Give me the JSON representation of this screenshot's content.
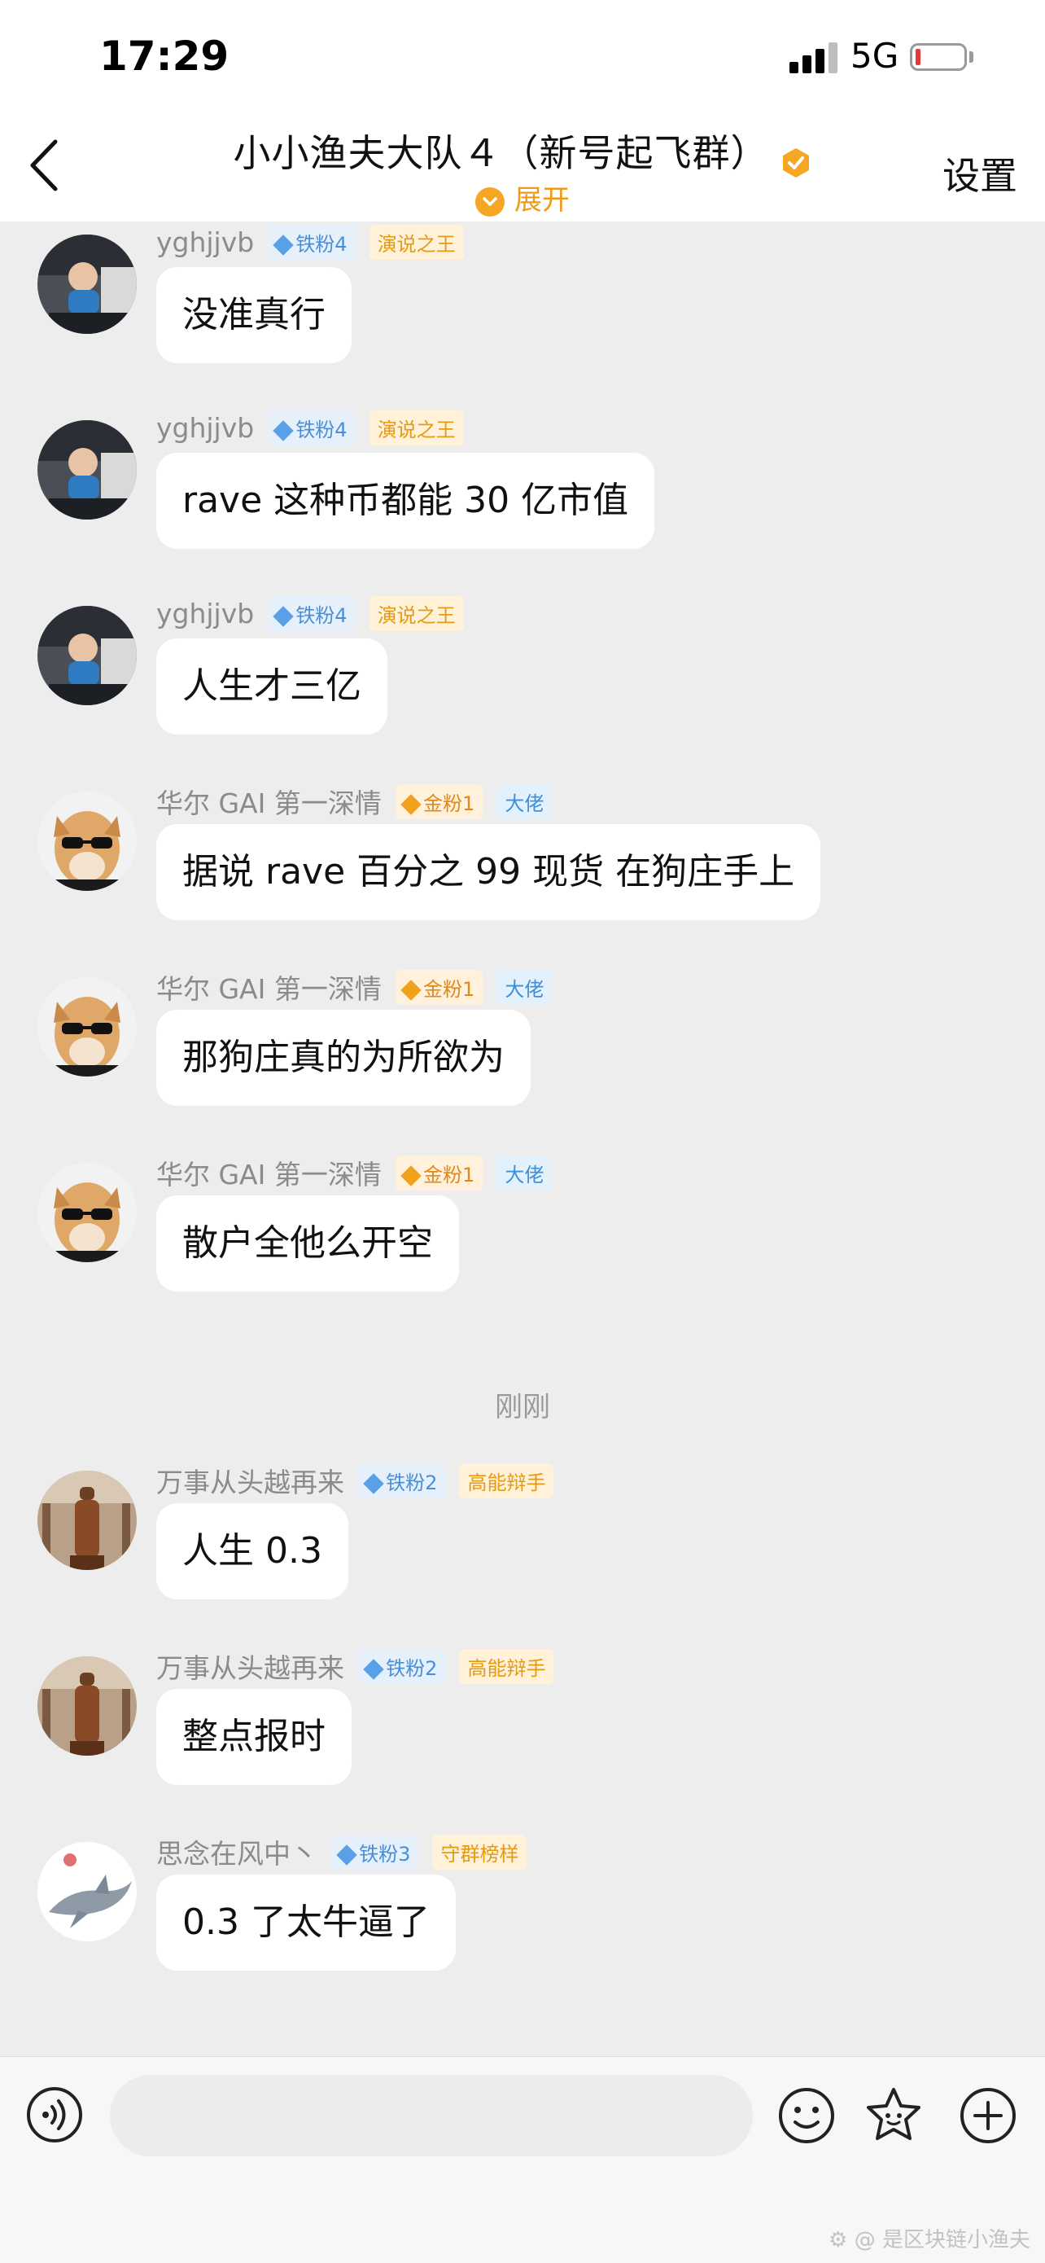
{
  "status_bar": {
    "time": "17:29",
    "network": "5G"
  },
  "header": {
    "title": "小小渔夫大队４（新号起飞群）",
    "expand_label": "展开",
    "settings_label": "设置"
  },
  "messages": [
    {
      "name": "yghjjvb",
      "fan_badge": "铁粉4",
      "title_badge": "演说之王",
      "text": "没准真行"
    },
    {
      "name": "yghjjvb",
      "fan_badge": "铁粉4",
      "title_badge": "演说之王",
      "text": "rave 这种币都能 30 亿市值"
    },
    {
      "name": "yghjjvb",
      "fan_badge": "铁粉4",
      "title_badge": "演说之王",
      "text": "人生才三亿"
    },
    {
      "name": "华尔 GAI 第一深情",
      "fan_badge": "金粉1",
      "title_badge": "大佬",
      "text": "据说 rave 百分之 99 现货 在狗庄手上"
    },
    {
      "name": "华尔 GAI 第一深情",
      "fan_badge": "金粉1",
      "title_badge": "大佬",
      "text": "那狗庄真的为所欲为"
    },
    {
      "name": "华尔 GAI 第一深情",
      "fan_badge": "金粉1",
      "title_badge": "大佬",
      "text": "散户全他么开空"
    },
    {
      "name": "万事从头越再来",
      "fan_badge": "铁粉2",
      "title_badge": "高能辩手",
      "text": "人生 0.3"
    },
    {
      "name": "万事从头越再来",
      "fan_badge": "铁粉2",
      "title_badge": "高能辩手",
      "text": "整点报时"
    },
    {
      "name": "思念在风中丶",
      "fan_badge": "铁粉3",
      "title_badge": "守群榜样",
      "text": "0.3 了太牛逼了"
    }
  ],
  "time_divider": "刚刚",
  "watermark": "是区块链小渔夫",
  "colors": {
    "accent": "#f5a623",
    "fan_blue": "#4a8fd6",
    "battery_low": "#e53935",
    "chat_bg": "#ededed"
  }
}
